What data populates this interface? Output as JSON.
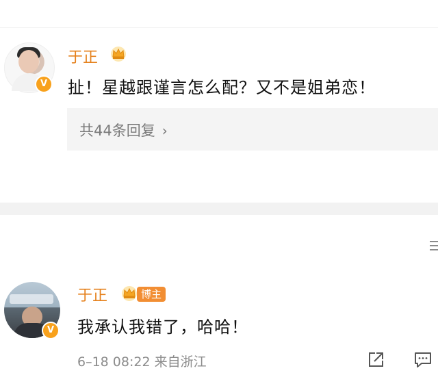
{
  "comments": [
    {
      "username": "于正",
      "verified_badge": "V",
      "text": "扯！星越跟谨言怎么配？又不是姐弟恋！",
      "replies_link": "共44条回复",
      "replies_chevron": "›"
    },
    {
      "username": "于正",
      "verified_badge": "V",
      "tag": "博主",
      "text": "我承认我错了，哈哈！",
      "timestamp": "6–18 08:22",
      "location": "来自浙江"
    }
  ],
  "colors": {
    "username": "#e5801b",
    "badge": "#f8a11c",
    "tag_bg": "#f28e33",
    "meta_text": "#8c8c8c"
  },
  "icons": {
    "crown": "crown-icon",
    "share": "share-icon",
    "comment": "comment-icon",
    "menu": "menu-icon"
  }
}
